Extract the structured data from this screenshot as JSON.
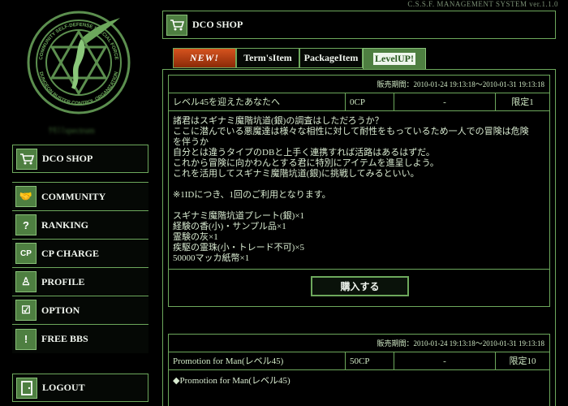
{
  "system_label": "C.S.S.F. MANAGEMENT SYSTEM ver.1.1.0",
  "emblem": {
    "top_text": "COMMUNITY SELF-DEFENSE SPECIAL FORCE",
    "bottom_text": "DUNGEON BUSTER CONTROL ORGANIZATION"
  },
  "user_name": "ｹﾓﾐﾐspectrum",
  "sidebar": {
    "shop_label": "DCO SHOP",
    "items": [
      {
        "label": "COMMUNITY",
        "icon": "handshake-icon",
        "glyph": "🤝"
      },
      {
        "label": "RANKING",
        "icon": "question-icon",
        "glyph": "?"
      },
      {
        "label": "CP CHARGE",
        "icon": "cp-icon",
        "glyph": "CP"
      },
      {
        "label": "PROFILE",
        "icon": "person-icon",
        "glyph": "♙"
      },
      {
        "label": "OPTION",
        "icon": "checkbox-icon",
        "glyph": "☑"
      },
      {
        "label": "FREE BBS",
        "icon": "exclamation-icon",
        "glyph": "!"
      }
    ],
    "logout_label": "LOGOUT"
  },
  "header": {
    "title": "DCO SHOP"
  },
  "tabs": [
    {
      "label": "NEW!",
      "state": "new"
    },
    {
      "label": "Term'sItem",
      "state": "normal"
    },
    {
      "label": "PackageItem",
      "state": "normal"
    },
    {
      "label": "LevelUP!",
      "state": "active"
    }
  ],
  "items": [
    {
      "sale_period": "販売期間：2010-01-24 19:13:18～2010-01-31 19:13:18",
      "name": "レベル45を迎えたあなたへ",
      "price": "0CP",
      "dash": "-",
      "limit": "限定1",
      "description": [
        "諸君はスギナミ魔階坑道(銀)の調査はしただろうか？",
        "ここに潜んでいる悪魔達は様々な相性に対して耐性をもっているため一人での冒険は危険",
        "を伴うか",
        "自分とは違うタイプのDBと上手く連携すれば活路はあるはずだ。",
        "これから冒険に向かわんとする君に特別にアイテムを進呈しよう。",
        "これを活用してスギナミ魔階坑道(銀)に挑戦してみるといい。",
        "",
        "※1IDにつき、1回のご利用となります。",
        "",
        "スギナミ魔階坑道プレート(銀)×1",
        "経験の香(小)・サンプル品×1",
        "霊験の灰×1",
        "疾駆の霊珠(小・トレード不可)×5",
        "50000マッカ紙幣×1"
      ],
      "buy_label": "購入する"
    },
    {
      "sale_period": "販売期間：2010-01-24 19:13:18～2010-01-31 19:13:18",
      "name": "Promotion for Man(レベル45)",
      "price": "50CP",
      "dash": "-",
      "limit": "限定10",
      "promo_line": "◆Promotion for Man(レベル45)"
    }
  ],
  "colors": {
    "accent": "#6da85c",
    "icon_bg": "#4e7f41",
    "new_tab": "#d6531e"
  }
}
